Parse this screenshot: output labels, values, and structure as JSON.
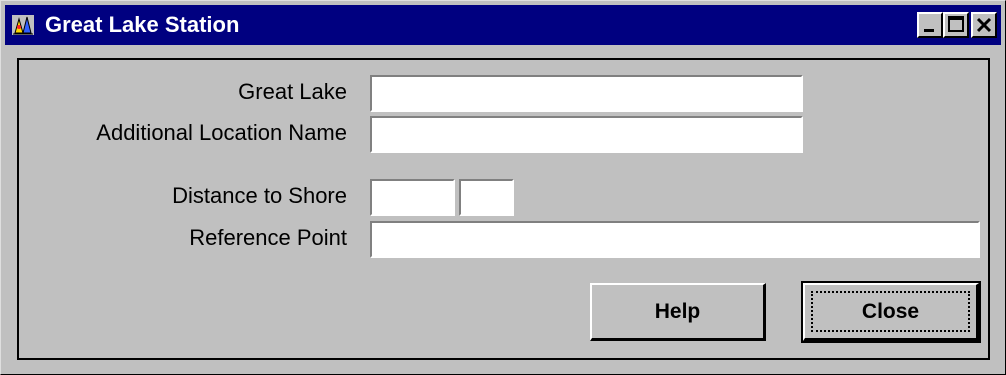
{
  "window": {
    "title": "Great Lake Station",
    "icon": "station-app-icon",
    "controls": {
      "minimize_icon": "minimize-icon",
      "maximize_icon": "maximize-icon",
      "close_icon": "close-icon"
    }
  },
  "form": {
    "great_lake": {
      "label": "Great Lake",
      "value": ""
    },
    "additional_location_name": {
      "label": "Additional Location Name",
      "value": ""
    },
    "distance_to_shore": {
      "label": "Distance to Shore",
      "value": "",
      "unit_value": ""
    },
    "reference_point": {
      "label": "Reference Point",
      "value": ""
    }
  },
  "buttons": {
    "help": "Help",
    "close": "Close"
  },
  "colors": {
    "titlebar": "#000080",
    "face": "#c0c0c0",
    "field": "#ffffff"
  }
}
